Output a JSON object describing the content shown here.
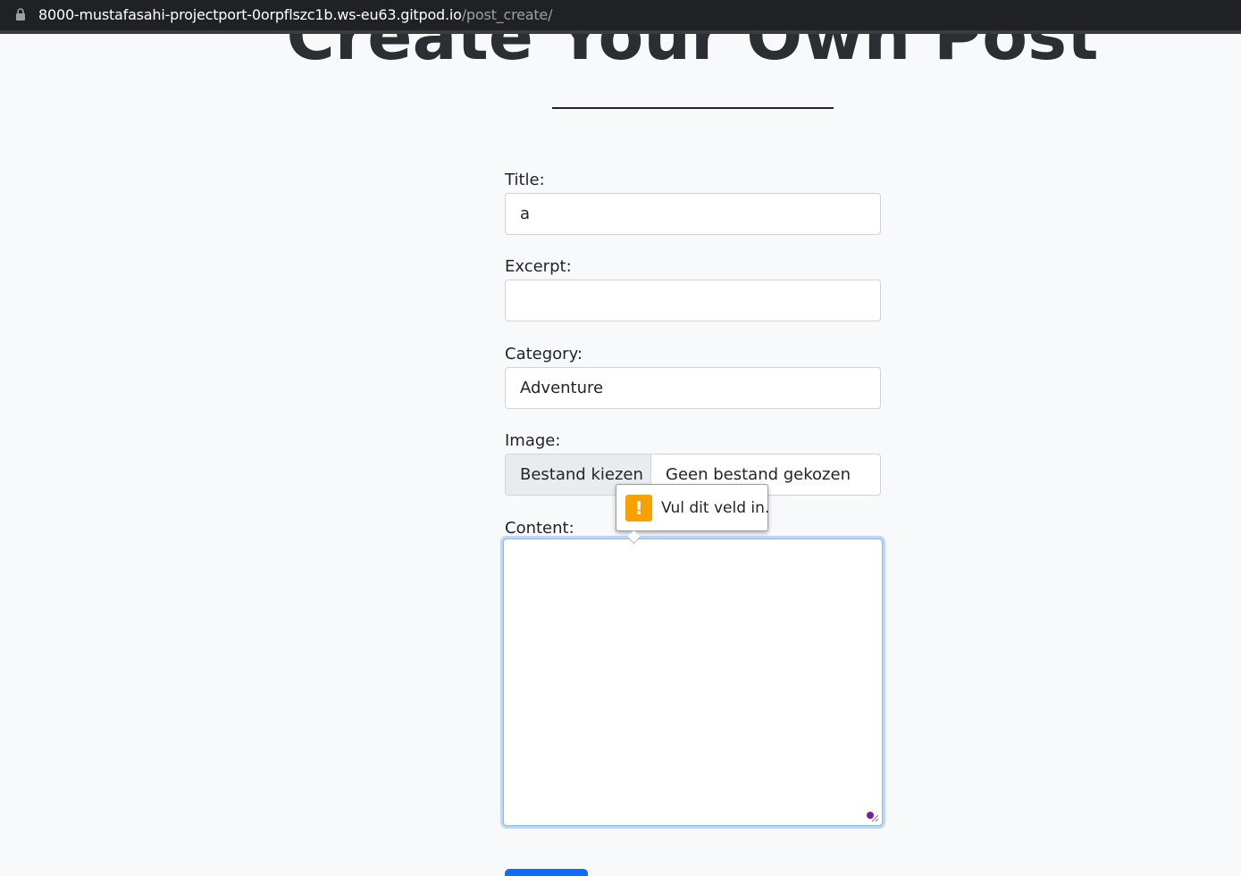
{
  "browser": {
    "url_host": "8000-mustafasahi-projectport-0orpflszc1b.ws-eu63.gitpod.io",
    "url_path": "/post_create/"
  },
  "page": {
    "heading": "Create Your Own Post"
  },
  "form": {
    "title_label": "Title:",
    "title_value": "a",
    "excerpt_label": "Excerpt:",
    "excerpt_value": "",
    "category_label": "Category:",
    "category_value": "Adventure",
    "image_label": "Image:",
    "file_button": "Bestand kiezen",
    "file_status": "Geen bestand gekozen",
    "content_label": "Content:",
    "content_value": ""
  },
  "validation": {
    "message": "Vul dit veld in.",
    "icon": "warning-icon"
  },
  "colors": {
    "accent": "#0d6efd",
    "warning": "#f9a100"
  }
}
